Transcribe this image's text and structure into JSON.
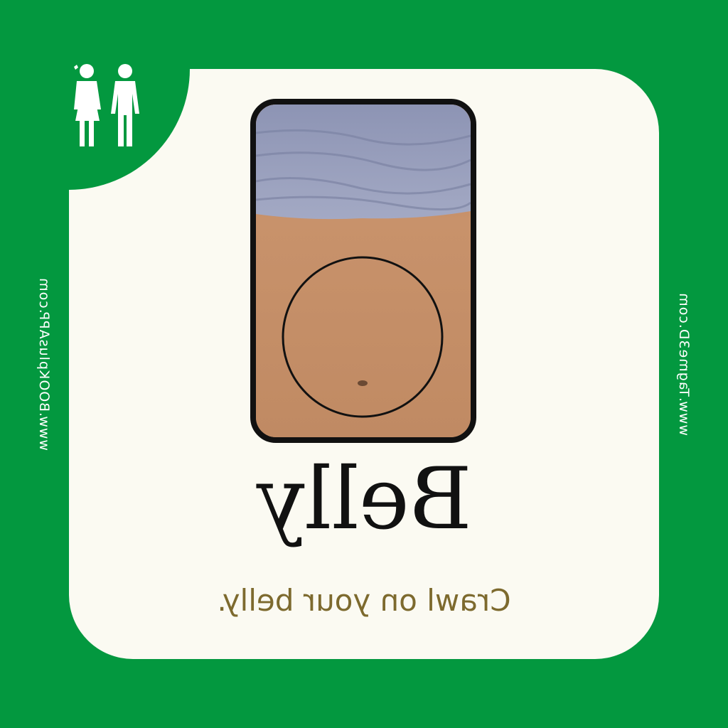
{
  "card": {
    "word": "Belly",
    "caption": "Crawl on your belly.",
    "mirrored": true
  },
  "side_text": {
    "left": "www.BOOKplusAPP.com",
    "right": "www.Tagme3D.com"
  },
  "icons": {
    "audience": "people-icon"
  },
  "colors": {
    "background_green": "#03983f",
    "card_cream": "#fbfaf2",
    "word_color": "#111111",
    "caption_color": "#7d6a2e",
    "frame_border": "#111111"
  }
}
